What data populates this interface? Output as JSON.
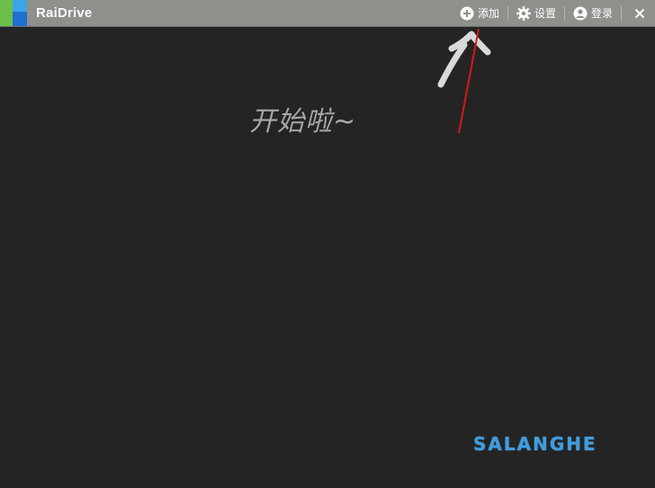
{
  "window": {
    "title": "RaiDrive"
  },
  "toolbar": {
    "add_label": "添加",
    "settings_label": "设置",
    "login_label": "登录"
  },
  "overlay": {
    "caption": "开始啦~"
  },
  "watermark": {
    "text": "SALANGHE"
  },
  "colors": {
    "titlebar_bg": "#8e908c",
    "main_bg": "#242424",
    "arrow_annotation": "#d31a1a",
    "watermark": "#3f9de0",
    "logo_green": "#6cc04a",
    "logo_blue": "#1e88e5"
  },
  "icons": {
    "add": "plus-circle",
    "settings": "gear",
    "login": "user-circle",
    "close": "x"
  }
}
